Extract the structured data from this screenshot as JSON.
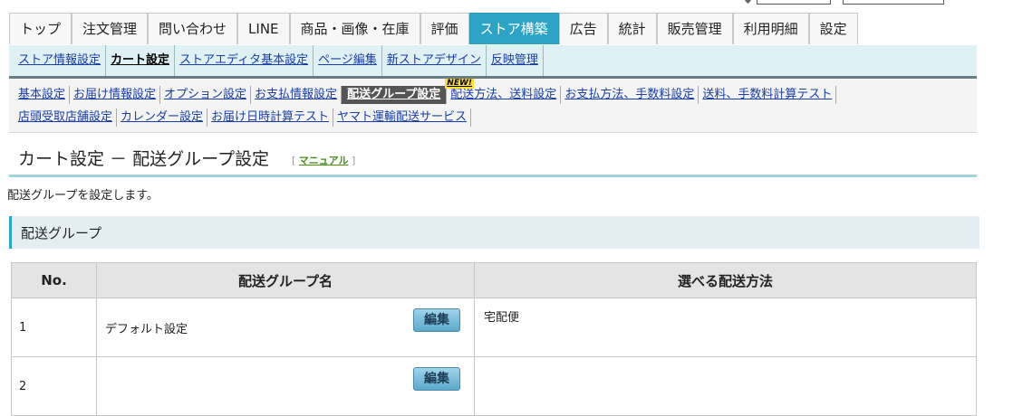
{
  "main_tabs": [
    {
      "label": "トップ"
    },
    {
      "label": "注文管理"
    },
    {
      "label": "問い合わせ"
    },
    {
      "label": "LINE"
    },
    {
      "label": "商品・画像・在庫"
    },
    {
      "label": "評価"
    },
    {
      "label": "ストア構築",
      "active": true
    },
    {
      "label": "広告"
    },
    {
      "label": "統計"
    },
    {
      "label": "販売管理"
    },
    {
      "label": "利用明細"
    },
    {
      "label": "設定"
    }
  ],
  "sub_nav": [
    {
      "label": "ストア情報設定"
    },
    {
      "label": "カート設定",
      "current": true
    },
    {
      "label": "ストアエディタ基本設定"
    },
    {
      "label": "ページ編集"
    },
    {
      "label": "新ストアデザイン"
    },
    {
      "label": "反映管理"
    }
  ],
  "sub_sub_nav": {
    "row1": [
      {
        "label": "基本設定"
      },
      {
        "label": "お届け情報設定"
      },
      {
        "label": "オプション設定"
      },
      {
        "label": "お支払情報設定"
      },
      {
        "label": "配送グループ設定",
        "current": true
      },
      {
        "label": "配送方法、送料設定",
        "badge": "NEW!"
      },
      {
        "label": "お支払方法、手数料設定"
      },
      {
        "label": "送料、手数料計算テスト"
      }
    ],
    "row2": [
      {
        "label": "店頭受取店舗設定"
      },
      {
        "label": "カレンダー設定"
      },
      {
        "label": "お届け日時計算テスト"
      },
      {
        "label": "ヤマト運輸配送サービス"
      }
    ]
  },
  "page": {
    "title": "カート設定 － 配送グループ設定",
    "manual_open": "[",
    "manual_label": "マニュアル",
    "manual_close": "]",
    "description": "配送グループを設定します。",
    "section_title": "配送グループ"
  },
  "table": {
    "headers": {
      "no": "No.",
      "name": "配送グループ名",
      "methods": "選べる配送方法"
    },
    "edit_label": "編集",
    "rows": [
      {
        "no": "1",
        "name": "デフォルト設定",
        "methods": "宅配便"
      },
      {
        "no": "2",
        "name": "",
        "methods": ""
      }
    ]
  },
  "colors": {
    "accent": "#2da4c5",
    "subnav_bg": "#dff1f5",
    "link": "#1a3da8"
  }
}
